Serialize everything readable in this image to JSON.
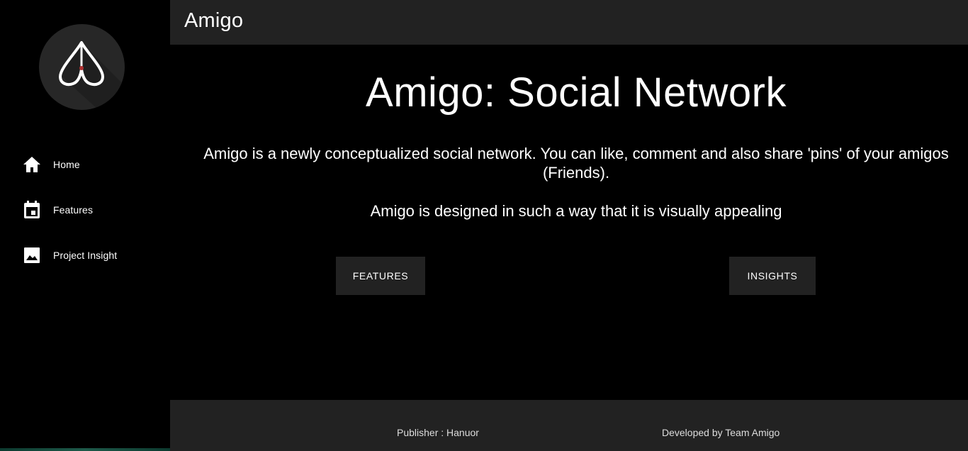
{
  "sidebar": {
    "logo_icon": "amigo-logo-icon",
    "items": [
      {
        "label": "Home",
        "icon": "home-icon"
      },
      {
        "label": "Features",
        "icon": "calendar-icon"
      },
      {
        "label": "Project Insight",
        "icon": "image-icon"
      }
    ]
  },
  "header": {
    "title": "Amigo"
  },
  "main": {
    "heading": "Amigo: Social Network",
    "description": "Amigo is a newly conceptualized social network. You can like, comment and also share 'pins' of your amigos (Friends).",
    "tagline": "Amigo is designed in such a way that it is visually appealing",
    "buttons": {
      "features": "FEATURES",
      "insights": "INSIGHTS"
    }
  },
  "footer": {
    "publisher": "Publisher : Hanuor",
    "developer": "Developed by Team Amigo"
  },
  "colors": {
    "background": "#000000",
    "panel": "#222222",
    "text": "#ffffff",
    "logo_accent": "#b03030"
  }
}
